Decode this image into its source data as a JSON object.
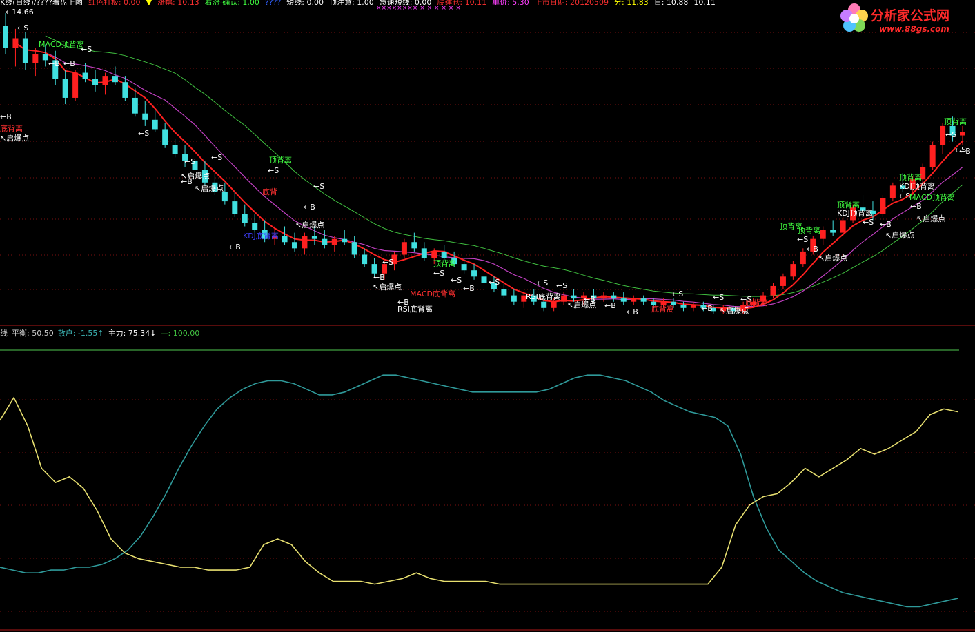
{
  "header": {
    "items": [
      {
        "text": "K线(日线)/????着盘上图",
        "color": "#ffffff"
      },
      {
        "text": "红色打板: 0.00",
        "color": "#ff3030"
      },
      {
        "text": "▼",
        "color": "#ffff00"
      },
      {
        "text": "涨幅: 10.13",
        "color": "#ff3030"
      },
      {
        "text": "看涨·确认: 1.00",
        "color": "#40ff40"
      },
      {
        "text": "????",
        "color": "#3060ff"
      },
      {
        "text": "短线: 0.00",
        "color": "#ffffff"
      },
      {
        "text": "顶注意: 1.00",
        "color": "#ffffff"
      },
      {
        "text": "急速短线: 0.00",
        "color": "#ffffff"
      },
      {
        "text": "底建仓: 10.11",
        "color": "#ff3030"
      },
      {
        "text": "单价: 5.30",
        "color": "#ff40ff"
      },
      {
        "text": "上市日期: 20120509",
        "color": "#ff3030"
      },
      {
        "text": "分: 11.83",
        "color": "#ffff00"
      },
      {
        "text": "日: 10.88",
        "color": "#ffffff"
      },
      {
        "text": "10.11",
        "color": "#ffffff"
      }
    ],
    "x_row": "××××××××   ×   ×   ×   ×   ×   ×"
  },
  "price_panel": {
    "high_label": "14.66",
    "annotations": [
      {
        "id": "a1",
        "text": "←S",
        "color": "#ffffff"
      },
      {
        "id": "a2",
        "text": "MACD顶背离",
        "color": "#40ff40"
      },
      {
        "id": "a3",
        "text": "←S",
        "color": "#ffffff"
      },
      {
        "id": "a4",
        "text": "←B",
        "color": "#ffffff"
      },
      {
        "id": "a5",
        "text": "←B",
        "color": "#ffffff"
      },
      {
        "id": "a6",
        "text": "←B",
        "color": "#ffffff"
      },
      {
        "id": "a7",
        "text": "底背离",
        "color": "#ff3030"
      },
      {
        "id": "a8",
        "text": "↖启爆点",
        "color": "#ffffff"
      },
      {
        "id": "a9",
        "text": "←S",
        "color": "#ffffff"
      },
      {
        "id": "a10",
        "text": "←S",
        "color": "#ffffff"
      },
      {
        "id": "a11",
        "text": "←S",
        "color": "#ffffff"
      },
      {
        "id": "a12",
        "text": "←B",
        "color": "#ffffff"
      },
      {
        "id": "a13",
        "text": "↖启爆点",
        "color": "#ffffff"
      },
      {
        "id": "a14",
        "text": "↖启爆点",
        "color": "#ffffff"
      },
      {
        "id": "a15",
        "text": "KDJ底背离",
        "color": "#4040ff"
      },
      {
        "id": "a16",
        "text": "←B",
        "color": "#ffffff"
      },
      {
        "id": "a17",
        "text": "顶背离",
        "color": "#40ff40"
      },
      {
        "id": "a18",
        "text": "←S",
        "color": "#ffffff"
      },
      {
        "id": "a19",
        "text": "底背",
        "color": "#ff3030"
      },
      {
        "id": "a20",
        "text": "←S",
        "color": "#ffffff"
      },
      {
        "id": "a21",
        "text": "←B",
        "color": "#ffffff"
      },
      {
        "id": "a22",
        "text": "↖启爆点",
        "color": "#ffffff"
      },
      {
        "id": "a23",
        "text": "←S",
        "color": "#ffffff"
      },
      {
        "id": "a24",
        "text": "←B",
        "color": "#ffffff"
      },
      {
        "id": "a25",
        "text": "↖启爆点",
        "color": "#ffffff"
      },
      {
        "id": "a26",
        "text": "←B",
        "color": "#ffffff"
      },
      {
        "id": "a27",
        "text": "MACD底背离",
        "color": "#ff3030"
      },
      {
        "id": "a28",
        "text": "RSI底背离",
        "color": "#ffffff"
      },
      {
        "id": "a29",
        "text": "顶背离",
        "color": "#40ff40"
      },
      {
        "id": "a30",
        "text": "←S",
        "color": "#ffffff"
      },
      {
        "id": "a31",
        "text": "←S",
        "color": "#ffffff"
      },
      {
        "id": "a32",
        "text": "←S",
        "color": "#ffffff"
      },
      {
        "id": "a33",
        "text": "←B",
        "color": "#ffffff"
      },
      {
        "id": "a34",
        "text": "←S",
        "color": "#ffffff"
      },
      {
        "id": "a35",
        "text": "←S",
        "color": "#ffffff"
      },
      {
        "id": "a36",
        "text": "RSI底背离",
        "color": "#ffffff"
      },
      {
        "id": "a37",
        "text": "←B",
        "color": "#ffffff"
      },
      {
        "id": "a38",
        "text": "↖启爆点",
        "color": "#ffffff"
      },
      {
        "id": "a39",
        "text": "←B",
        "color": "#ffffff"
      },
      {
        "id": "a40",
        "text": "←S",
        "color": "#ffffff"
      },
      {
        "id": "a41",
        "text": "←B",
        "color": "#ffffff"
      },
      {
        "id": "a42",
        "text": "底背离",
        "color": "#ff3030"
      },
      {
        "id": "a43",
        "text": "←S",
        "color": "#ffffff"
      },
      {
        "id": "a44",
        "text": "←S",
        "color": "#ffffff"
      },
      {
        "id": "a45",
        "text": "←B",
        "color": "#ffffff"
      },
      {
        "id": "a46",
        "text": "底背离",
        "color": "#ff3030"
      },
      {
        "id": "a47",
        "text": "↖启爆点",
        "color": "#ffffff"
      },
      {
        "id": "a48",
        "text": "顶背离",
        "color": "#40ff40"
      },
      {
        "id": "a49",
        "text": "顶背离",
        "color": "#40ff40"
      },
      {
        "id": "a50",
        "text": "←S",
        "color": "#ffffff"
      },
      {
        "id": "a51",
        "text": "←B",
        "color": "#ffffff"
      },
      {
        "id": "a52",
        "text": "↖启爆点",
        "color": "#ffffff"
      },
      {
        "id": "a53",
        "text": "顶背离",
        "color": "#40ff40"
      },
      {
        "id": "a54",
        "text": "KDJ顶背离",
        "color": "#ffffff"
      },
      {
        "id": "a55",
        "text": "←S",
        "color": "#ffffff"
      },
      {
        "id": "a56",
        "text": "←B",
        "color": "#ffffff"
      },
      {
        "id": "a57",
        "text": "↖启爆点",
        "color": "#ffffff"
      },
      {
        "id": "a58",
        "text": "顶背离",
        "color": "#40ff40"
      },
      {
        "id": "a59",
        "text": "KDJ顶背离",
        "color": "#ffffff"
      },
      {
        "id": "a60",
        "text": "←S",
        "color": "#ffffff"
      },
      {
        "id": "a61",
        "text": "MACD顶背离",
        "color": "#40ff40"
      },
      {
        "id": "a62",
        "text": "←B",
        "color": "#ffffff"
      },
      {
        "id": "a63",
        "text": "↖启爆点",
        "color": "#ffffff"
      },
      {
        "id": "a64",
        "text": "顶背离",
        "color": "#40ff40"
      },
      {
        "id": "a65",
        "text": "←S",
        "color": "#ffffff"
      },
      {
        "id": "a66",
        "text": "←S",
        "color": "#ffffff"
      },
      {
        "id": "a67",
        "text": "←B",
        "color": "#ffffff"
      }
    ]
  },
  "indicator_legend": [
    {
      "text": "线",
      "color": "#cccccc"
    },
    {
      "text": "平衡: 50.50",
      "color": "#cccccc"
    },
    {
      "text": "散户: -1.55↑",
      "color": "#3cb4b4"
    },
    {
      "text": "主力: 75.34↓",
      "color": "#ffffff"
    },
    {
      "text": "—: 100.00",
      "color": "#40c040"
    }
  ],
  "logo": {
    "text": "分析家公式网",
    "url": "www.88gs.com"
  },
  "colors": {
    "up": "#ff2020",
    "down": "#40e0e0",
    "ma_fast": "#ff2020",
    "ma_mid": "#c040c0",
    "ma_slow": "#40c040",
    "retail": "#2f9a9a",
    "main": "#e8e070",
    "ref": "#40a040",
    "grid": "#7a1010"
  },
  "chart_data": [
    {
      "type": "candlestick",
      "title": "",
      "candles_ohlc": [
        [
          14.3,
          14.7,
          13.4,
          13.6
        ],
        [
          13.6,
          14.2,
          13.0,
          13.9
        ],
        [
          13.9,
          14.1,
          12.9,
          13.1
        ],
        [
          13.1,
          13.6,
          12.7,
          13.4
        ],
        [
          13.4,
          13.7,
          13.0,
          13.2
        ],
        [
          13.2,
          13.5,
          12.4,
          12.6
        ],
        [
          12.6,
          12.9,
          11.8,
          12.0
        ],
        [
          12.0,
          12.9,
          11.9,
          12.8
        ],
        [
          12.8,
          13.1,
          12.5,
          12.6
        ],
        [
          12.6,
          12.9,
          12.2,
          12.4
        ],
        [
          12.4,
          12.8,
          12.1,
          12.7
        ],
        [
          12.7,
          13.0,
          12.4,
          12.5
        ],
        [
          12.5,
          12.7,
          11.9,
          12.0
        ],
        [
          12.0,
          12.3,
          11.4,
          11.5
        ],
        [
          11.5,
          11.9,
          11.1,
          11.3
        ],
        [
          11.3,
          11.6,
          10.9,
          11.0
        ],
        [
          11.0,
          11.2,
          10.4,
          10.5
        ],
        [
          10.5,
          10.7,
          10.1,
          10.2
        ],
        [
          10.2,
          10.5,
          9.8,
          10.0
        ],
        [
          10.0,
          10.3,
          9.6,
          9.7
        ],
        [
          9.7,
          10.0,
          9.2,
          9.3
        ],
        [
          9.3,
          9.6,
          8.9,
          9.0
        ],
        [
          9.0,
          9.3,
          8.6,
          8.7
        ],
        [
          8.7,
          9.0,
          8.2,
          8.3
        ],
        [
          8.3,
          8.6,
          7.9,
          8.0
        ],
        [
          8.0,
          8.3,
          7.7,
          7.8
        ],
        [
          7.8,
          8.1,
          7.4,
          7.5
        ],
        [
          7.5,
          7.9,
          7.3,
          7.6
        ],
        [
          7.6,
          7.9,
          7.3,
          7.4
        ],
        [
          7.4,
          7.7,
          7.1,
          7.2
        ],
        [
          7.2,
          7.7,
          7.0,
          7.6
        ],
        [
          7.6,
          7.9,
          7.3,
          7.5
        ],
        [
          7.5,
          7.8,
          7.2,
          7.3
        ],
        [
          7.3,
          7.6,
          7.1,
          7.5
        ],
        [
          7.5,
          7.8,
          7.3,
          7.4
        ],
        [
          7.4,
          7.6,
          6.9,
          7.0
        ],
        [
          7.0,
          7.2,
          6.6,
          6.7
        ],
        [
          6.7,
          6.9,
          6.3,
          6.4
        ],
        [
          6.4,
          6.8,
          6.2,
          6.7
        ],
        [
          6.7,
          7.1,
          6.5,
          7.0
        ],
        [
          7.0,
          7.5,
          6.9,
          7.4
        ],
        [
          7.4,
          7.7,
          7.1,
          7.2
        ],
        [
          7.2,
          7.4,
          6.8,
          6.9
        ],
        [
          6.9,
          7.2,
          6.7,
          7.1
        ],
        [
          7.1,
          7.3,
          6.8,
          6.9
        ],
        [
          6.9,
          7.1,
          6.6,
          6.7
        ],
        [
          6.7,
          6.9,
          6.4,
          6.5
        ],
        [
          6.5,
          6.7,
          6.2,
          6.3
        ],
        [
          6.3,
          6.5,
          6.0,
          6.1
        ],
        [
          6.1,
          6.3,
          5.8,
          5.9
        ],
        [
          5.9,
          6.1,
          5.6,
          5.7
        ],
        [
          5.7,
          5.9,
          5.4,
          5.5
        ],
        [
          5.5,
          5.8,
          5.3,
          5.7
        ],
        [
          5.7,
          5.9,
          5.4,
          5.5
        ],
        [
          5.5,
          5.7,
          5.2,
          5.3
        ],
        [
          5.3,
          5.6,
          5.2,
          5.5
        ],
        [
          5.5,
          5.8,
          5.4,
          5.7
        ],
        [
          5.7,
          5.9,
          5.5,
          5.6
        ],
        [
          5.6,
          5.8,
          5.4,
          5.7
        ],
        [
          5.7,
          5.9,
          5.5,
          5.6
        ],
        [
          5.6,
          5.8,
          5.5,
          5.7
        ],
        [
          5.7,
          5.8,
          5.5,
          5.6
        ],
        [
          5.6,
          5.8,
          5.4,
          5.5
        ],
        [
          5.5,
          5.7,
          5.4,
          5.6
        ],
        [
          5.6,
          5.7,
          5.4,
          5.5
        ],
        [
          5.5,
          5.6,
          5.3,
          5.4
        ],
        [
          5.4,
          5.6,
          5.3,
          5.5
        ],
        [
          5.5,
          5.6,
          5.3,
          5.4
        ],
        [
          5.4,
          5.5,
          5.2,
          5.3
        ],
        [
          5.3,
          5.5,
          5.2,
          5.4
        ],
        [
          5.4,
          5.5,
          5.2,
          5.3
        ],
        [
          5.3,
          5.4,
          5.1,
          5.2
        ],
        [
          5.2,
          5.4,
          5.1,
          5.3
        ],
        [
          5.3,
          5.4,
          5.1,
          5.2
        ],
        [
          5.2,
          5.5,
          5.1,
          5.4
        ],
        [
          5.4,
          5.6,
          5.3,
          5.5
        ],
        [
          5.5,
          5.8,
          5.4,
          5.7
        ],
        [
          5.7,
          6.1,
          5.6,
          6.0
        ],
        [
          6.0,
          6.4,
          5.9,
          6.3
        ],
        [
          6.3,
          6.8,
          6.2,
          6.7
        ],
        [
          6.7,
          7.2,
          6.6,
          7.1
        ],
        [
          7.1,
          7.6,
          7.0,
          7.5
        ],
        [
          7.5,
          7.9,
          7.3,
          7.8
        ],
        [
          7.8,
          8.1,
          7.6,
          7.7
        ],
        [
          7.7,
          8.2,
          7.6,
          8.1
        ],
        [
          8.1,
          8.6,
          8.0,
          8.5
        ],
        [
          8.5,
          8.9,
          8.3,
          8.4
        ],
        [
          8.4,
          8.7,
          8.1,
          8.3
        ],
        [
          8.3,
          8.9,
          8.2,
          8.8
        ],
        [
          8.8,
          9.3,
          8.7,
          9.2
        ],
        [
          9.2,
          9.6,
          9.0,
          9.1
        ],
        [
          9.1,
          9.5,
          8.9,
          9.4
        ],
        [
          9.4,
          9.9,
          9.3,
          9.8
        ],
        [
          9.8,
          10.6,
          9.7,
          10.5
        ],
        [
          10.5,
          11.2,
          10.2,
          11.1
        ],
        [
          11.1,
          11.4,
          10.6,
          10.8
        ],
        [
          10.8,
          11.1,
          10.5,
          10.9
        ]
      ],
      "high_label": 14.66,
      "indicator": {
        "ref_line": 100,
        "retail_series": [
          20,
          19,
          18,
          18,
          19,
          19,
          20,
          20,
          21,
          23,
          26,
          31,
          38,
          46,
          55,
          63,
          70,
          76,
          80,
          83,
          85,
          86,
          86,
          85,
          83,
          81,
          81,
          82,
          84,
          86,
          88,
          88,
          87,
          86,
          85,
          84,
          83,
          82,
          82,
          82,
          82,
          82,
          82,
          83,
          85,
          87,
          88,
          88,
          87,
          86,
          84,
          82,
          79,
          77,
          75,
          74,
          73,
          70,
          60,
          45,
          34,
          26,
          22,
          18,
          15,
          13,
          11,
          10,
          9,
          8,
          7,
          6,
          6,
          7,
          8,
          9
        ],
        "main_series": [
          72,
          80,
          70,
          55,
          50,
          52,
          48,
          40,
          30,
          25,
          23,
          22,
          21,
          20,
          20,
          19,
          19,
          19,
          20,
          28,
          30,
          28,
          22,
          18,
          15,
          15,
          15,
          14,
          15,
          16,
          18,
          16,
          15,
          15,
          15,
          15,
          14,
          14,
          14,
          14,
          14,
          14,
          14,
          14,
          14,
          14,
          14,
          14,
          14,
          14,
          14,
          14,
          20,
          35,
          42,
          45,
          46,
          50,
          55,
          52,
          55,
          58,
          62,
          60,
          62,
          65,
          68,
          74,
          76,
          75
        ],
        "main_label": 75.34,
        "retail_label": -1.55,
        "balance_label": 50.5
      }
    }
  ]
}
